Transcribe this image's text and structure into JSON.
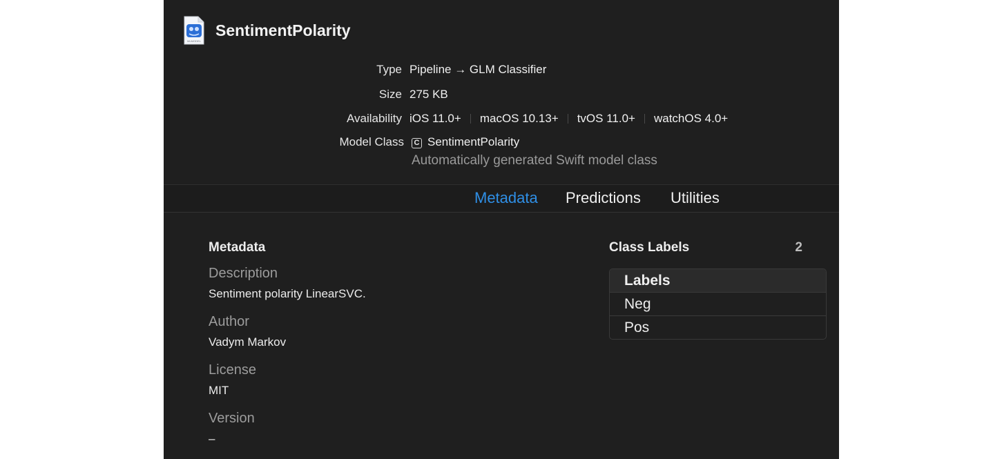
{
  "model": {
    "name": "SentimentPolarity",
    "icon_name": "mlmodel-file-icon",
    "icon_caption": "MLMODEL"
  },
  "info": {
    "type_label": "Type",
    "type_value": "Pipeline → GLM Classifier",
    "size_label": "Size",
    "size_value": "275 KB",
    "availability_label": "Availability",
    "platforms": [
      "iOS 11.0+",
      "macOS 10.13+",
      "tvOS 11.0+",
      "watchOS 4.0+"
    ],
    "model_class_label": "Model Class",
    "class_badge": "C",
    "model_class_value": "SentimentPolarity",
    "model_class_note": "Automatically generated Swift model class"
  },
  "tabs": [
    {
      "label": "Metadata",
      "active": true
    },
    {
      "label": "Predictions",
      "active": false
    },
    {
      "label": "Utilities",
      "active": false
    }
  ],
  "metadata": {
    "title": "Metadata",
    "description_label": "Description",
    "description_value": "Sentiment polarity LinearSVC.",
    "author_label": "Author",
    "author_value": "Vadym Markov",
    "license_label": "License",
    "license_value": "MIT",
    "version_label": "Version",
    "version_value": "–"
  },
  "class_labels": {
    "title": "Class Labels",
    "count": "2",
    "header": "Labels",
    "items": [
      "Neg",
      "Pos"
    ]
  },
  "colors": {
    "background": "#1f1f1f",
    "accent": "#2f8fe6",
    "secondary_text": "#9c9c9c"
  }
}
